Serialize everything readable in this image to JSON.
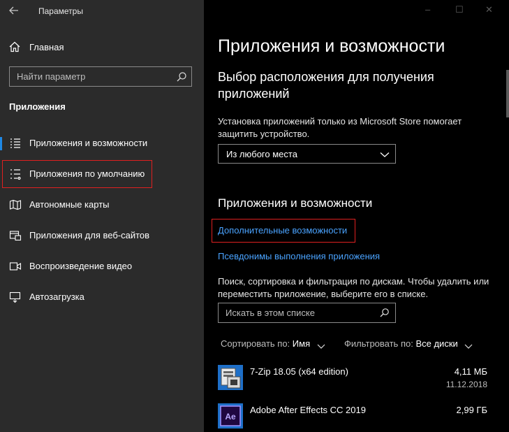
{
  "window": {
    "title": "Параметры",
    "controls": [
      "–",
      "☐",
      "✕"
    ]
  },
  "sidebar": {
    "home_label": "Главная",
    "search_placeholder": "Найти параметр",
    "section_title": "Приложения",
    "items": [
      {
        "label": "Приложения и возможности",
        "icon": "apps-features-icon",
        "active": true
      },
      {
        "label": "Приложения по умолчанию",
        "icon": "default-apps-icon",
        "highlighted": true
      },
      {
        "label": "Автономные карты",
        "icon": "offline-maps-icon"
      },
      {
        "label": "Приложения для веб-сайтов",
        "icon": "apps-for-websites-icon"
      },
      {
        "label": "Воспроизведение видео",
        "icon": "video-playback-icon"
      },
      {
        "label": "Автозагрузка",
        "icon": "startup-icon"
      }
    ]
  },
  "main": {
    "page_title": "Приложения и возможности",
    "install_section": {
      "title": "Выбор расположения для получения приложений",
      "description": "Установка приложений только из Microsoft Store помогает защитить устройство.",
      "dropdown_value": "Из любого места"
    },
    "apps_section": {
      "title": "Приложения и возможности",
      "link_optional_features": "Дополнительные возможности",
      "link_aliases": "Псевдонимы выполнения приложения",
      "description": "Поиск, сортировка и фильтрация по дискам. Чтобы удалить или переместить приложение, выберите его в списке.",
      "search_placeholder": "Искать в этом списке",
      "sort_label": "Сортировать по:",
      "sort_value": "Имя",
      "filter_label": "Фильтровать по:",
      "filter_value": "Все диски"
    },
    "apps": [
      {
        "name": "7-Zip 18.05 (x64 edition)",
        "size": "4,11 МБ",
        "date": "11.12.2018",
        "icon": "7zip-icon"
      },
      {
        "name": "Adobe After Effects CC 2019",
        "size": "2,99 ГБ",
        "date": "",
        "icon": "after-effects-icon",
        "icon_text": "Ae"
      }
    ]
  },
  "colors": {
    "accent": "#1e88e5",
    "link": "#4aa3ff",
    "highlight": "#e02020",
    "sidebar_bg": "#2b2b2b",
    "content_bg": "#000000"
  }
}
